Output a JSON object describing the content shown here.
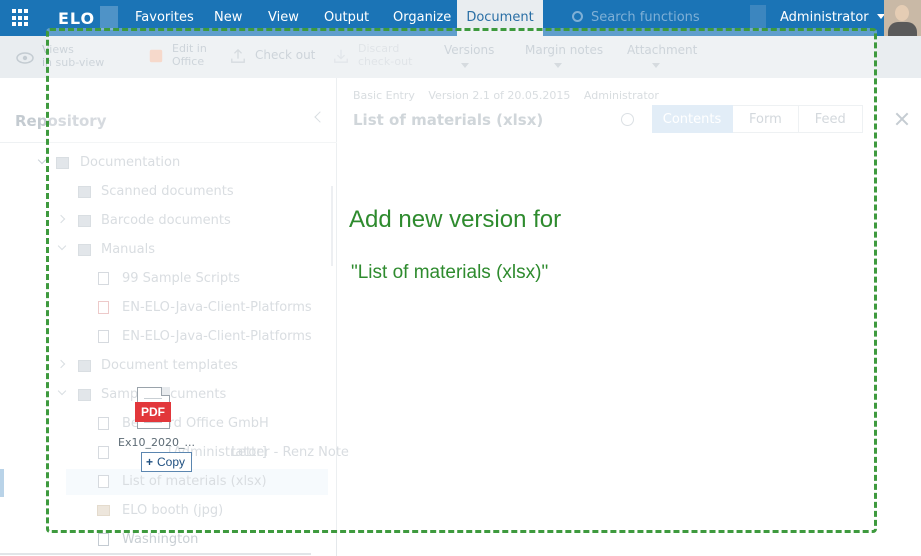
{
  "app": {
    "logo": "ELO"
  },
  "topbar": {
    "menus": [
      "Favorites",
      "New",
      "View",
      "Output",
      "Organize",
      "Document"
    ],
    "active_menu": "Document",
    "search_placeholder": "Search functions",
    "user": "Administrator"
  },
  "ribbon": {
    "view_label": "Views",
    "view_sub": "in sub-view",
    "edit_office_label": "Edit in",
    "edit_office_sub": "Office",
    "checkout_label": "Check out",
    "checkin_label": "Discard",
    "checkin_sub": "check-out",
    "versions_label": "Versions",
    "margin_notes_label": "Margin notes",
    "attachment_label": "Attachment"
  },
  "repository": {
    "title": "Repository",
    "items": [
      {
        "label": "Documentation",
        "icon": "cabinet-icon"
      },
      {
        "label": "Scanned documents",
        "icon": "folder-icon"
      },
      {
        "label": "Barcode documents",
        "icon": "folder-icon"
      },
      {
        "label": "Manuals",
        "icon": "folder-icon"
      },
      {
        "label": "99 Sample Scripts",
        "icon": "document-icon"
      },
      {
        "label": "EN-ELO-Java-Client-Platforms",
        "icon": "pdf-icon"
      },
      {
        "label": "EN-ELO-Java-Client-Platforms",
        "icon": "document-icon"
      },
      {
        "label": "Document templates",
        "icon": "folder-icon"
      },
      {
        "label": "Sample documents",
        "icon": "folder-icon"
      },
      {
        "label": "Bernhard Office GmbH",
        "icon": "document-icon"
      },
      {
        "label": "Letter - Renz Note",
        "icon": "document-icon"
      },
      {
        "label": "List of materials (xlsx)",
        "icon": "document-icon"
      },
      {
        "label": "ELO booth (jpg)",
        "icon": "image-icon"
      },
      {
        "label": "Washington",
        "icon": "document-icon"
      }
    ],
    "extra_label": "[Administrator]"
  },
  "document": {
    "meta": [
      "Basic Entry",
      "Version 2.1 of 20.05.2015",
      "Administrator"
    ],
    "title": "List of materials (xlsx)",
    "tabs": [
      "Contents",
      "Form",
      "Feed"
    ],
    "active_tab": "Contents"
  },
  "drop_overlay": {
    "title": "Add new version for",
    "document_name": "\"List of materials (xlsx)\""
  },
  "drag": {
    "file_type": "PDF",
    "file_name": "Ex10_2020_...",
    "action": "Copy"
  },
  "colors": {
    "top_bar": "#1b74b6",
    "drop_border": "#3e9a3e",
    "drop_text": "#2e8b2e",
    "pdf_badge": "#e2373b"
  }
}
